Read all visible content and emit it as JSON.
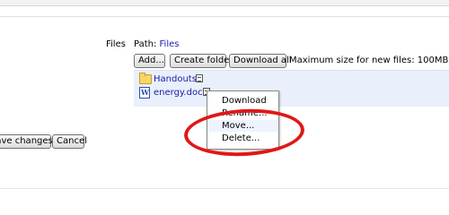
{
  "form": {
    "files_label": "Files",
    "path_label": "Path:",
    "path_link": "Files",
    "buttons": {
      "add": "Add...",
      "create_folder": "Create folder",
      "download_all": "Download all"
    },
    "max_size_text": "Maximum size for new files: 100MB",
    "items": [
      {
        "name": "Handouts",
        "type": "folder",
        "icon": "folder-icon"
      },
      {
        "name": "energy.doc",
        "type": "file",
        "icon": "word-doc-icon"
      }
    ],
    "context_menu": [
      "Download",
      "Rename...",
      "Move...",
      "Delete..."
    ],
    "footer": {
      "save": "Save changes",
      "cancel": "Cancel"
    }
  },
  "annotation": {
    "color": "#e01818",
    "shape": "ellipse around Move... and Delete..."
  }
}
